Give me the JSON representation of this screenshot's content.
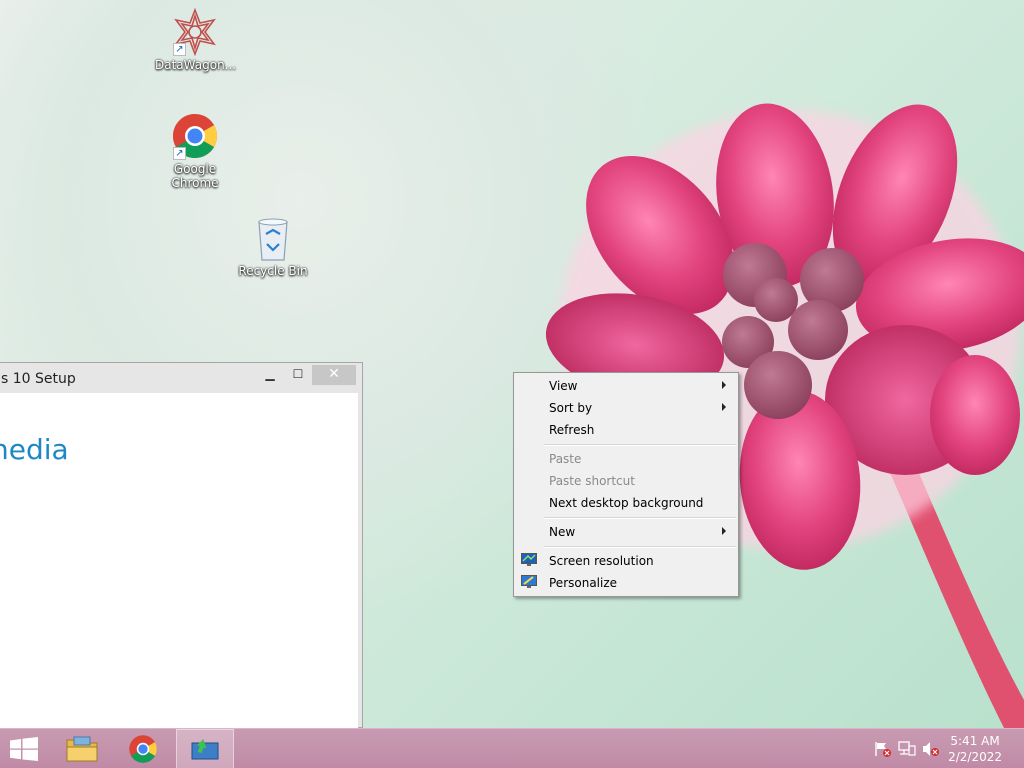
{
  "desktop_icons": [
    {
      "label": "DataWagon...",
      "icon": "datawagon-icon"
    },
    {
      "label": "Google\nChrome",
      "icon": "chrome-icon"
    },
    {
      "label": "Recycle Bin",
      "icon": "recycle-bin-icon"
    }
  ],
  "setup_window": {
    "title": "s 10 Setup",
    "heading": "nedia",
    "minimize": "▁",
    "maximize": "☐",
    "close": "✕"
  },
  "context_menu": {
    "items": [
      {
        "label": "View",
        "submenu": true,
        "enabled": true
      },
      {
        "label": "Sort by",
        "submenu": true,
        "enabled": true
      },
      {
        "label": "Refresh",
        "submenu": false,
        "enabled": true
      },
      {
        "label": "Paste",
        "submenu": false,
        "enabled": false
      },
      {
        "label": "Paste shortcut",
        "submenu": false,
        "enabled": false
      },
      {
        "label": "Next desktop background",
        "submenu": false,
        "enabled": true
      },
      {
        "label": "New",
        "submenu": true,
        "enabled": true
      },
      {
        "label": "Screen resolution",
        "submenu": false,
        "enabled": true,
        "icon": "display-icon"
      },
      {
        "label": "Personalize",
        "submenu": false,
        "enabled": true,
        "icon": "personalize-icon"
      }
    ]
  },
  "taskbar": {
    "buttons": [
      {
        "name": "start",
        "icon": "windows-logo-icon"
      },
      {
        "name": "file-explorer",
        "icon": "folder-icon"
      },
      {
        "name": "chrome",
        "icon": "chrome-icon"
      },
      {
        "name": "setup",
        "icon": "setup-icon",
        "active": true
      }
    ],
    "tray": {
      "icons": [
        "action-center-flag-icon",
        "network-icon",
        "volume-muted-icon"
      ],
      "time": "5:41 AM",
      "date": "2/2/2022"
    }
  },
  "colors": {
    "accent": "#1e88c7",
    "taskbar": "#c08aa6",
    "flower": "#e0457f"
  }
}
